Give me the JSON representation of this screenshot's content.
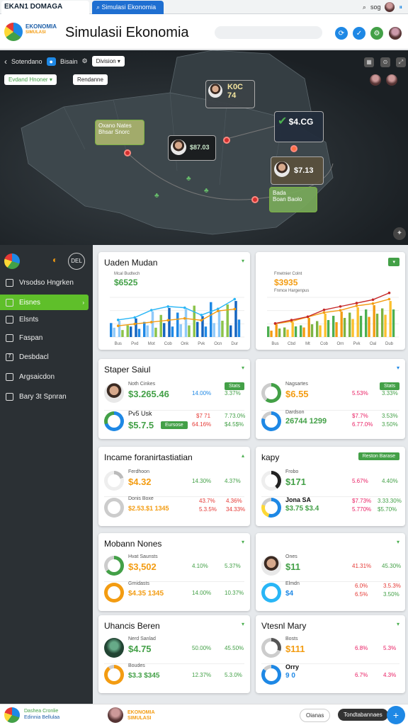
{
  "browser": {
    "tab1": "EKAN1 DOMAGA",
    "tab2": "Simulasi Ekonomia",
    "search": "sog"
  },
  "header": {
    "brand_line1": "EKONOMIA",
    "brand_line2": "SIMULASI",
    "title": "Simulasii Ekonomia"
  },
  "map": {
    "back": "Sotendano",
    "selector": "Bisain",
    "dropdown": "Division",
    "filter": "Evdand Hnoner",
    "filter_btn": "Rendanne",
    "cards": [
      {
        "label": "",
        "value": "K0C 74"
      },
      {
        "label": "Oxano Nates",
        "value": "Bhsar Snorc"
      },
      {
        "label": "",
        "value": "$87.03"
      },
      {
        "label": "",
        "value": "$4.CG"
      },
      {
        "label": "",
        "value": "$7.13"
      },
      {
        "label": "Bada",
        "value": "Boan Baolo"
      }
    ],
    "pin_label": "1"
  },
  "sidebar": {
    "badge": "DEL",
    "items": [
      {
        "label": "Vrsodso Hngrken"
      },
      {
        "label": "Eisnes"
      },
      {
        "label": "Elsnts"
      },
      {
        "label": "Faspan"
      },
      {
        "label": "Desbdacl"
      },
      {
        "label": "Argsaicdon"
      },
      {
        "label": "Bary 3t Spnran"
      }
    ]
  },
  "colors": {
    "accent": "#5fbf2a",
    "blue": "#1e88e5",
    "orange": "#f39c12",
    "pink": "#e91e63"
  },
  "panels": {
    "p1": {
      "title": "Uaden Mudan",
      "sublabel": "Mcal Budtech",
      "value": "$6525"
    },
    "p2": {
      "title": "",
      "sublabel": "Fmetnier Colnt",
      "value": "$3935",
      "sublabel2": "Fnmce Hargenpus"
    },
    "p3": {
      "title": "Staper Saiul",
      "btn": "Stats",
      "rows": [
        {
          "label": "Noth Cinkes",
          "value": "$3.265.46",
          "c1": "14.00%",
          "c2": "3.37%"
        },
        {
          "label": "Pv5 Usk",
          "value": "$5.7.5",
          "btn": "Eursose",
          "c1": "$7 71",
          "c2": "7.73.0%",
          "c3": "64.16%",
          "c4": "$4.5$%"
        }
      ]
    },
    "p4": {
      "btn": "Stats",
      "rows": [
        {
          "label": "Nagsartes",
          "value": "$6.55",
          "c1": "5.53%",
          "c2": "3.33%"
        },
        {
          "label": "Dardson",
          "value": "26744 1299",
          "c1": "$7.7%",
          "c2": "3.53%",
          "c3": "6.77.0%",
          "c4": "3.50%"
        }
      ]
    },
    "p5": {
      "title": "Incame foranirtastiatian",
      "rows": [
        {
          "label": "Ferdhoon",
          "value": "$4.32",
          "c1": "14.30%",
          "c2": "4.37%"
        },
        {
          "label": "Donis Boxe",
          "value": "$2.53.$1 1345",
          "c1": "43.7%",
          "c2": "4.36%",
          "c3": "5.3.5%",
          "c4": "34.33%"
        }
      ]
    },
    "p6": {
      "title": "kapy",
      "btn": "Reston Barase",
      "rows": [
        {
          "label": "Frobo",
          "value": "$171",
          "c1": "5.67%",
          "c2": "4.40%"
        },
        {
          "label": "Jona SA",
          "value": "$3.75 $3.4",
          "c1": "$7.73%",
          "c2": "3.33.30%",
          "c3": "5.770%",
          "c4": "$5.70%"
        }
      ]
    },
    "p7": {
      "title": "Mobann Nones",
      "rows": [
        {
          "label": "Hvat Saunsts",
          "value": "$3,502",
          "c1": "4.10%",
          "c2": "5.37%"
        },
        {
          "label": "Grnidasts",
          "value": "$4.35 1345",
          "c1": "14.00%",
          "c2": "10.37%"
        }
      ]
    },
    "p8": {
      "rows": [
        {
          "label": "Ones",
          "value": "$11",
          "c1": "41.31%",
          "c2": "45.30%"
        },
        {
          "label": "Elmdn",
          "value": "$4",
          "c1": "6.0%",
          "c2": "3.5.3%",
          "c3": "6.5%",
          "c4": "3.50%"
        }
      ]
    },
    "p9": {
      "title": "Uhancis Beren",
      "rows": [
        {
          "label": "Nerd Sanlad",
          "value": "$4.75",
          "c1": "50.00%",
          "c2": "45.50%"
        },
        {
          "label": "Boudes",
          "value": "$3.3 $345",
          "c1": "12.37%",
          "c2": "5.3.0%"
        }
      ]
    },
    "p10": {
      "title": "Vtesnl Mary",
      "rows": [
        {
          "label": "Bosts",
          "value": "$111",
          "c1": "6.8%",
          "c2": "5.3%"
        },
        {
          "label": "Orry",
          "value": "9 0",
          "c1": "6.7%",
          "c2": "4.3%"
        }
      ]
    }
  },
  "chart_data": [
    {
      "type": "bar",
      "title": "Uaden Mudan",
      "categories": [
        "Bus",
        "Pvd",
        "Mot",
        "Cob",
        "Onk",
        "Pvk",
        "Ocn",
        "Dur"
      ],
      "series": [
        {
          "values": [
            12,
            14,
            10,
            16,
            13,
            22,
            19,
            25,
            21,
            24,
            27,
            18,
            30,
            23,
            28,
            31
          ]
        },
        {
          "values": [
            8,
            6,
            9,
            7,
            10,
            8,
            12,
            9,
            11,
            10,
            13,
            9,
            12,
            14,
            10,
            15
          ]
        }
      ]
    },
    {
      "type": "bar",
      "categories": [
        "Bus",
        "Cbd",
        "Mt",
        "Cob",
        "Orn",
        "Pvk",
        "Oal",
        "Dub"
      ],
      "series": [
        {
          "values": [
            10,
            12,
            9,
            14,
            11,
            18,
            15,
            22,
            20,
            24,
            23,
            28,
            26,
            30,
            27,
            34
          ]
        },
        {
          "values": [
            6,
            8,
            7,
            10,
            9,
            12,
            11,
            16,
            14,
            18,
            17,
            20,
            19,
            22,
            21,
            26
          ]
        }
      ]
    }
  ],
  "bottom": {
    "brand": "Dashea Cronlie",
    "brand2": "Edinnia Bellulaa",
    "center": "EKONOMIA SIMULASI",
    "btn1": "Oianas",
    "btn2": "Tondtabannaes"
  }
}
